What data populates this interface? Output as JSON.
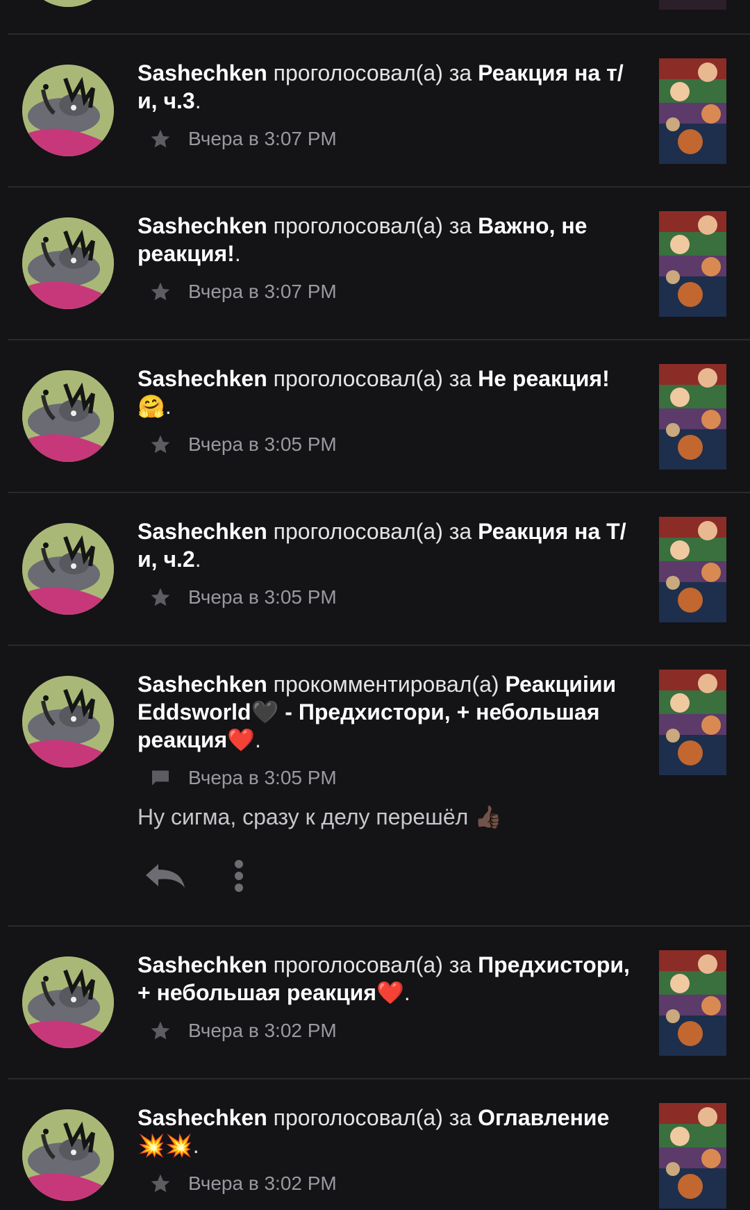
{
  "feed": {
    "items": [
      {
        "user": "Sashechken",
        "action": " проголосовал(а) за ",
        "title": "Реакция на т/и, ч.3",
        "suffix": ".",
        "time": "Вчера в 3:07 PM",
        "type": "vote",
        "meta_icon": "star-icon"
      },
      {
        "user": "Sashechken",
        "action": " проголосовал(а) за ",
        "title": "Важно, не реакция!",
        "suffix": ".",
        "time": "Вчера в 3:07 PM",
        "type": "vote",
        "meta_icon": "star-icon"
      },
      {
        "user": "Sashechken",
        "action": " проголосовал(а) за ",
        "title": "Не реакция! 🤗",
        "suffix": ".",
        "time": "Вчера в 3:05 PM",
        "type": "vote",
        "meta_icon": "star-icon"
      },
      {
        "user": "Sashechken",
        "action": " проголосовал(а) за ",
        "title": "Реакция на Т/и, ч.2",
        "suffix": ".",
        "time": "Вчера в 3:05 PM",
        "type": "vote",
        "meta_icon": "star-icon"
      },
      {
        "user": "Sashechken",
        "action": " прокомментировал(а) ",
        "title": "Реакциiии Eddsworld🖤 - Предхистори, + небольшая реакция❤️",
        "suffix": ".",
        "time": "Вчера в 3:05 PM",
        "type": "comment",
        "meta_icon": "comment-icon",
        "comment": "Ну сигма, сразу к делу перешёл 👍🏿"
      },
      {
        "user": "Sashechken",
        "action": " проголосовал(а) за ",
        "title": "Предхистори, + небольшая реакция❤️",
        "suffix": ".",
        "time": "Вчера в 3:02 PM",
        "type": "vote",
        "meta_icon": "star-icon"
      },
      {
        "user": "Sashechken",
        "action": " проголосовал(а) за ",
        "title": "Оглавление 💥💥",
        "suffix": ".",
        "time": "Вчера в 3:02 PM",
        "type": "vote",
        "meta_icon": "star-icon"
      }
    ],
    "reply_icon": "reply-icon",
    "more_icon": "more-vertical-icon"
  },
  "colors": {
    "background": "#141316",
    "divider": "#2a292d",
    "username": "#ffffff",
    "body_text": "#e4e4e4",
    "meta_text": "#9a99a0",
    "comment_text": "#c8c7cc"
  }
}
